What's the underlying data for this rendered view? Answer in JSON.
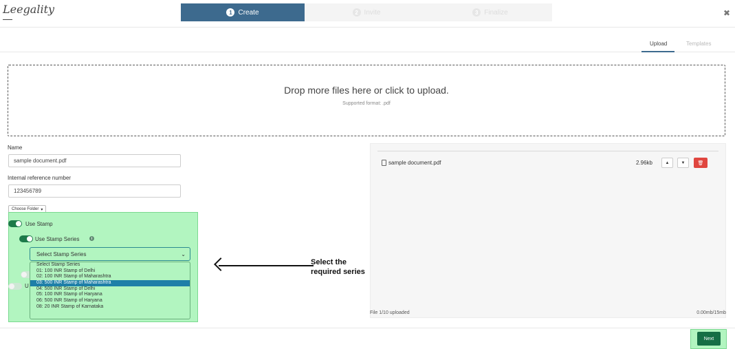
{
  "header": {
    "logo_text": "Leegality",
    "steps": [
      {
        "num": "1",
        "label": "Create"
      },
      {
        "num": "2",
        "label": "Invite"
      },
      {
        "num": "3",
        "label": "Finalize"
      }
    ],
    "close_glyph": "✖"
  },
  "tabs": {
    "upload": "Upload",
    "templates": "Templates"
  },
  "dropzone": {
    "title": "Drop more files here or click to upload.",
    "subtitle": "Supported format: .pdf"
  },
  "form": {
    "name_label": "Name",
    "name_value": "sample document.pdf",
    "ref_label": "Internal reference number",
    "ref_value": "123456789",
    "folder_label": "Choose Folder",
    "use_stamp_label": "Use Stamp",
    "use_stamp_series_label": "Use Stamp Series",
    "partial_label": "U",
    "select_value": "Select Stamp Series",
    "options": [
      "Select Stamp Series",
      "01: 100 INR Stamp of Delhi",
      "02: 100 INR Stamp of Maharashtra",
      "03: 500 INR Stamp of Maharashtra",
      "04: 500 INR Stamp of Delhi",
      "05: 100 INR Stamp of Haryana",
      "06: 500 INR Stamp of Haryana",
      "08: 20 INR Stamp of Karnataka"
    ],
    "selected_option_index": 3
  },
  "annotation": {
    "line1": "Select the",
    "line2": "required series"
  },
  "files": {
    "items": [
      {
        "name": "sample document.pdf",
        "size": "2.96kb"
      }
    ],
    "uploaded_text": "File 1/10 uploaded",
    "quota_text": "0.00mb/15mb"
  },
  "footer": {
    "next_label": "Next"
  },
  "colors": {
    "primary": "#3d6a8e",
    "highlight": "#b2f5c0",
    "toggle_on": "#1d7a4a",
    "delete": "#e0463f",
    "next": "#166e45",
    "option_selected": "#1e7fa8"
  }
}
